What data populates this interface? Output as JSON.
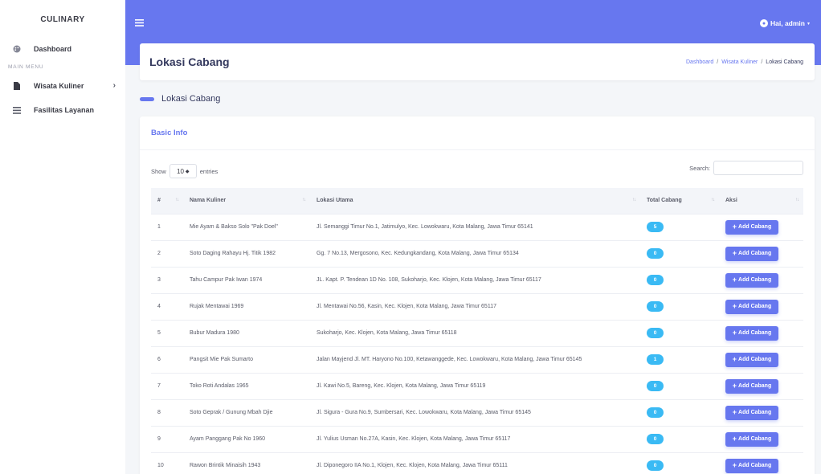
{
  "sidebar": {
    "brand": "CULINARY",
    "dashboard_label": "Dashboard",
    "section_label": "MAIN MENU",
    "items": [
      {
        "label": "Wisata Kuliner"
      },
      {
        "label": "Fasilitas Layanan"
      }
    ]
  },
  "topbar": {
    "user_label": "Hai, admin"
  },
  "header": {
    "title": "Lokasi Cabang",
    "breadcrumb": [
      "Dashboard",
      "Wisata Kuliner",
      "Lokasi Cabang"
    ],
    "separator": "/"
  },
  "section": {
    "title": "Lokasi Cabang"
  },
  "card": {
    "title": "Basic Info",
    "show_label": "Show",
    "entries_value": "10",
    "entries_label": "entries",
    "search_label": "Search:",
    "search_value": ""
  },
  "table": {
    "columns": [
      "#",
      "Nama Kuliner",
      "Lokasi Utama",
      "Total Cabang",
      "Aksi"
    ],
    "action_label": "Add Cabang",
    "rows": [
      {
        "no": "1",
        "name": "Mie Ayam & Bakso Solo \"Pak Doel\"",
        "location": "Jl. Semanggi Timur No.1, Jatimulyo, Kec. Lowokwaru, Kota Malang, Jawa Timur 65141",
        "total": "5"
      },
      {
        "no": "2",
        "name": "Soto Daging Rahayu Hj. Titik 1982",
        "location": "Gg. 7 No.13, Mergosono, Kec. Kedungkandang, Kota Malang, Jawa Timur 65134",
        "total": "0"
      },
      {
        "no": "3",
        "name": "Tahu Campur Pak Iwan 1974",
        "location": "JL. Kapt. P. Tendean 1D No. 108, Sukoharjo, Kec. Klojen, Kota Malang, Jawa Timur 65117",
        "total": "0"
      },
      {
        "no": "4",
        "name": "Rujak Mentawai 1969",
        "location": "Jl. Mentawai No.56, Kasin, Kec. Klojen, Kota Malang, Jawa Timur 65117",
        "total": "0"
      },
      {
        "no": "5",
        "name": "Bubur Madura 1980",
        "location": "Sukoharjo, Kec. Klojen, Kota Malang, Jawa Timur 65118",
        "total": "0"
      },
      {
        "no": "6",
        "name": "Pangsit Mie Pak Sumarto",
        "location": "Jalan Mayjend Jl. MT. Haryono No.100, Ketawanggede, Kec. Lowokwaru, Kota Malang, Jawa Timur 65145",
        "total": "1"
      },
      {
        "no": "7",
        "name": "Toko Roti Andalas 1965",
        "location": "Jl. Kawi No.5, Bareng, Kec. Klojen, Kota Malang, Jawa Timur 65119",
        "total": "0"
      },
      {
        "no": "8",
        "name": "Soto Geprak / Gunung Mbah Djie",
        "location": "Jl. Sigura - Gura No.9, Sumbersari, Kec. Lowokwaru, Kota Malang, Jawa Timur 65145",
        "total": "0"
      },
      {
        "no": "9",
        "name": "Ayam Panggang Pak No 1960",
        "location": "Jl. Yulius Usman No.27A, Kasin, Kec. Klojen, Kota Malang, Jawa Timur 65117",
        "total": "0"
      },
      {
        "no": "10",
        "name": "Rawon Brintik Minaisih 1943",
        "location": "Jl. Diponegoro IIA No.1, Klojen, Kec. Klojen, Kota Malang, Jawa Timur 65111",
        "total": "0"
      }
    ]
  }
}
